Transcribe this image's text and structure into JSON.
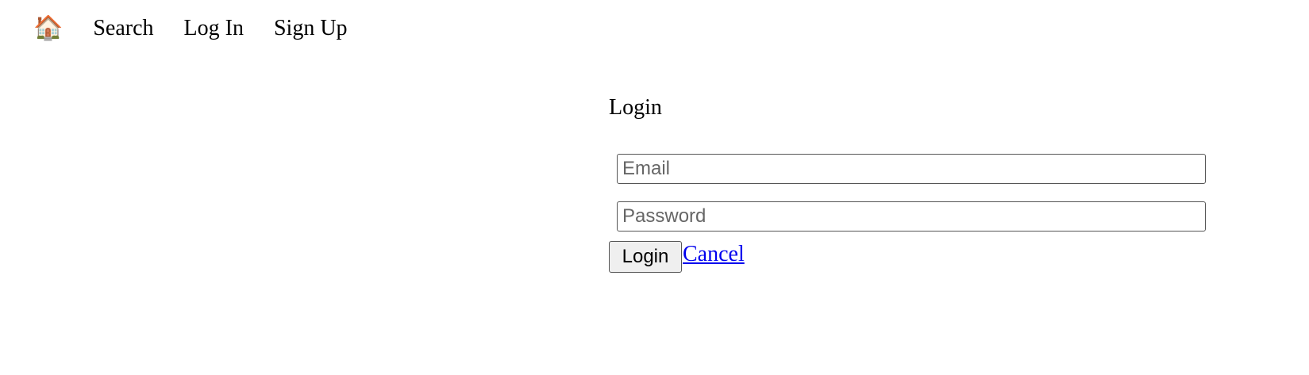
{
  "nav": {
    "home_icon": "🏠",
    "search": "Search",
    "login": "Log In",
    "signup": "Sign Up"
  },
  "form": {
    "title": "Login",
    "email_placeholder": "Email",
    "password_placeholder": "Password",
    "submit": "Login",
    "cancel": "Cancel"
  }
}
